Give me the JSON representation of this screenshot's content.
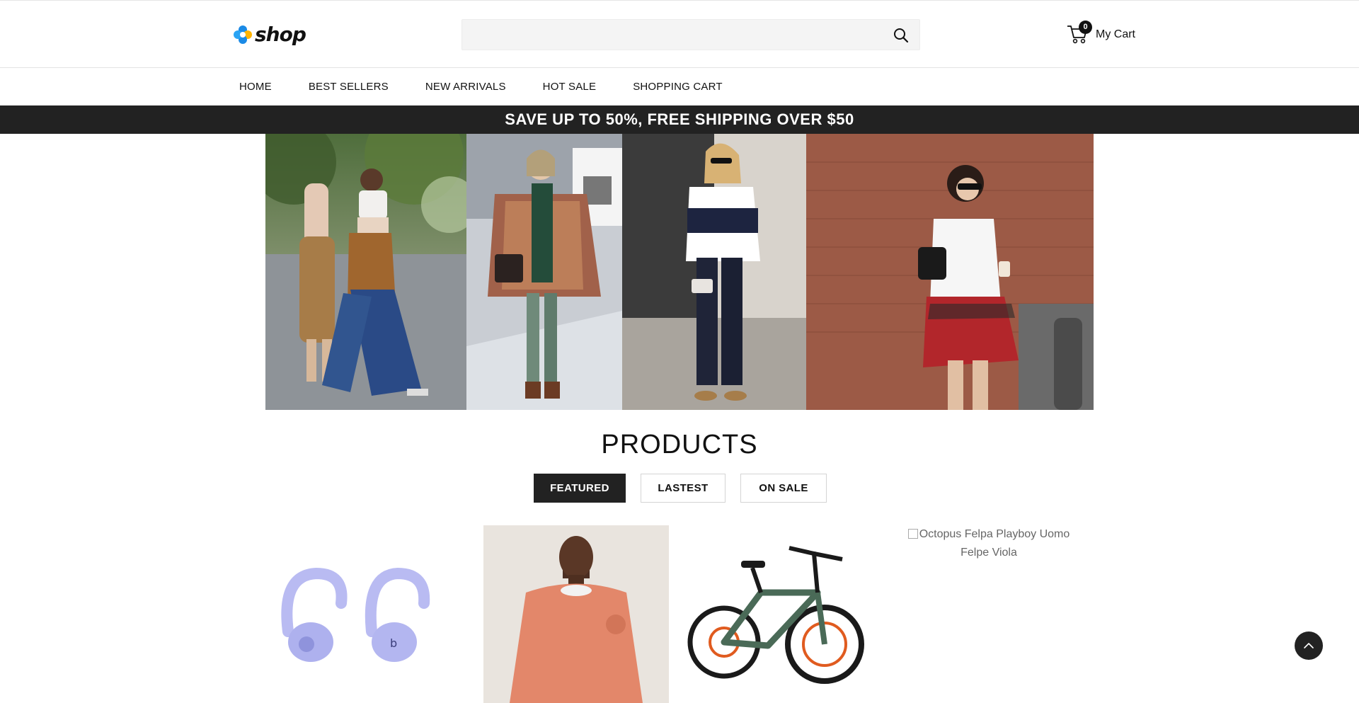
{
  "header": {
    "logo_text": "shop",
    "search_placeholder": "",
    "cart_count": "0",
    "cart_label": "My Cart"
  },
  "nav": {
    "items": [
      "HOME",
      "BEST SELLERS",
      "NEW ARRIVALS",
      "HOT SALE",
      "SHOPPING CART"
    ]
  },
  "promo": {
    "text": "SAVE UP TO 50%, FREE SHIPPING OVER $50"
  },
  "products": {
    "title": "PRODUCTS",
    "tabs": [
      "FEATURED",
      "LASTEST",
      "ON SALE"
    ],
    "active_tab": "FEATURED",
    "broken_image_alt": "Octopus Felpa Playboy Uomo Felpe Viola"
  },
  "colors": {
    "dark": "#222222",
    "logo_blue": "#1a8ae6",
    "logo_yellow": "#ffb400"
  }
}
